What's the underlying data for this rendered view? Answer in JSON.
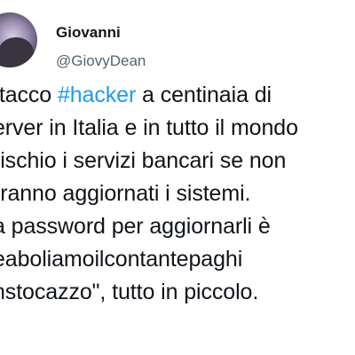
{
  "tweet": {
    "author": {
      "display_name": "Giovanni",
      "handle": "@GiovyDean"
    },
    "text": {
      "line1_before": "ttacco ",
      "line1_hashtag": "#hacker",
      "line1_after": " a centinaia di",
      "line2": "erver in Italia e in tutto il mondo",
      "line3": "rischio i servizi bancari se non",
      "line4": "rranno aggiornati i sistemi.",
      "line5": "a password per aggiornarli è",
      "line6": "eaboliamoilcontantepaghi",
      "line7": "nstocazzo\", tutto in piccolo."
    },
    "colors": {
      "hashtag": "#1d9bf0",
      "text": "#0f1419",
      "handle": "#536471"
    }
  }
}
